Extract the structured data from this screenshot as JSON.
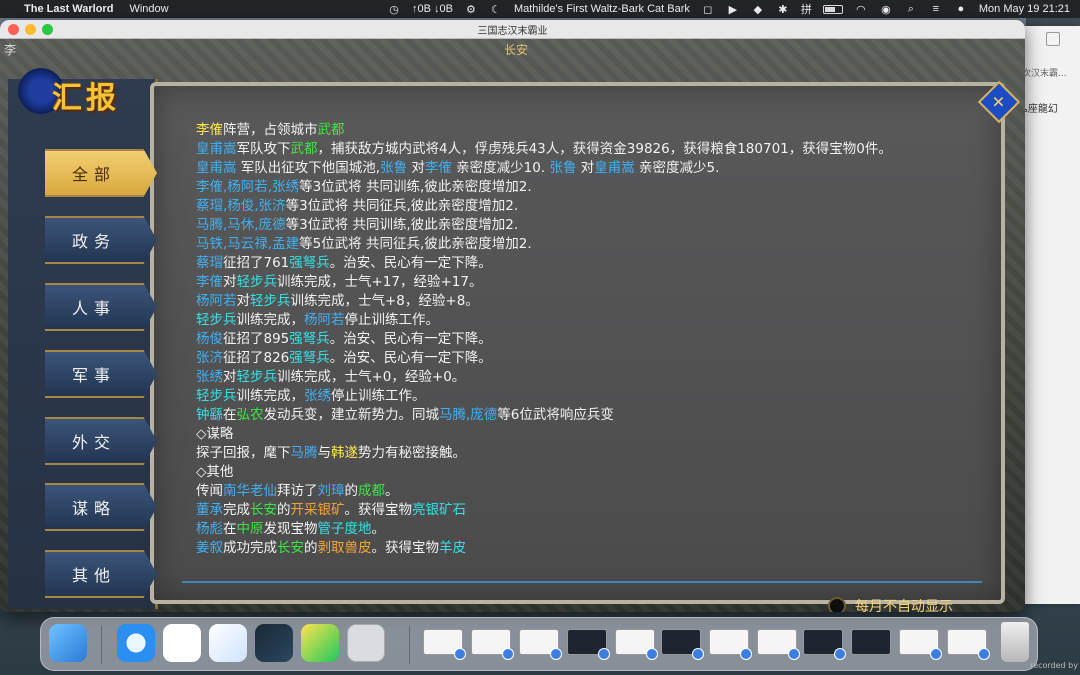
{
  "menubar": {
    "app_name": "The Last Warlord",
    "menu_window": "Window",
    "network": "↑0B ↓0B",
    "now_playing": "Mathilde's First Waltz-Bark Cat Bark",
    "input_method": "拼",
    "datetime": "Mon May 19  21:21"
  },
  "window": {
    "title": "三国志汉末霸业"
  },
  "game": {
    "hud_left": "李",
    "hud_city": "长安",
    "panel_title": "汇报",
    "categories": [
      "全部",
      "政务",
      "人事",
      "军事",
      "外交",
      "谋略",
      "其他"
    ],
    "report_lines": [
      [
        [
          "李傕",
          "y"
        ],
        [
          "阵营，占领城市",
          "w"
        ],
        [
          "武都",
          "g"
        ]
      ],
      [
        [
          "皇甫嵩",
          "b"
        ],
        [
          "军队攻下",
          "w"
        ],
        [
          "武都",
          "g"
        ],
        [
          "，捕获敌方城内武将4人，俘虏残兵43人，获得资金39826，获得粮食180701，获得宝物0件。",
          "w"
        ]
      ],
      [
        [
          "皇甫嵩",
          "b"
        ],
        [
          " 军队出征攻下他国城池,",
          "w"
        ],
        [
          "张鲁",
          "b"
        ],
        [
          " 对",
          "w"
        ],
        [
          "李傕",
          "b"
        ],
        [
          " 亲密度减少10. ",
          "w"
        ],
        [
          "张鲁",
          "b"
        ],
        [
          " 对",
          "w"
        ],
        [
          "皇甫嵩",
          "b"
        ],
        [
          " 亲密度减少5.",
          "w"
        ]
      ],
      [
        [
          "李傕,杨阿若,张绣",
          "b"
        ],
        [
          "等3位武将 共同训练,彼此亲密度增加2.",
          "w"
        ]
      ],
      [
        [
          "蔡瑁,杨俊,张济",
          "b"
        ],
        [
          "等3位武将 共同征兵,彼此亲密度增加2.",
          "w"
        ]
      ],
      [
        [
          "马腾,马休,庞德",
          "b"
        ],
        [
          "等3位武将 共同训练,彼此亲密度增加2.",
          "w"
        ]
      ],
      [
        [
          "马铁,马云禄,孟建",
          "b"
        ],
        [
          "等5位武将 共同征兵,彼此亲密度增加2.",
          "w"
        ]
      ],
      [
        [
          "蔡瑁",
          "b"
        ],
        [
          "征招了761",
          "w"
        ],
        [
          "强弩兵",
          "c"
        ],
        [
          "。治安、民心有一定下降。",
          "w"
        ]
      ],
      [
        [
          "李傕",
          "b"
        ],
        [
          "对",
          "w"
        ],
        [
          "轻步兵",
          "c"
        ],
        [
          "训练完成，士气+17，经验+17。",
          "w"
        ]
      ],
      [
        [
          "杨阿若",
          "b"
        ],
        [
          "对",
          "w"
        ],
        [
          "轻步兵",
          "c"
        ],
        [
          "训练完成，士气+8，经验+8。",
          "w"
        ]
      ],
      [
        [
          "轻步兵",
          "c"
        ],
        [
          "训练完成，",
          "w"
        ],
        [
          "杨阿若",
          "b"
        ],
        [
          "停止训练工作。",
          "w"
        ]
      ],
      [
        [
          "杨俊",
          "b"
        ],
        [
          "征招了895",
          "w"
        ],
        [
          "强弩兵",
          "c"
        ],
        [
          "。治安、民心有一定下降。",
          "w"
        ]
      ],
      [
        [
          "张济",
          "b"
        ],
        [
          "征招了826",
          "w"
        ],
        [
          "强弩兵",
          "c"
        ],
        [
          "。治安、民心有一定下降。",
          "w"
        ]
      ],
      [
        [
          "张绣",
          "b"
        ],
        [
          "对",
          "w"
        ],
        [
          "轻步兵",
          "c"
        ],
        [
          "训练完成，士气+0，经验+0。",
          "w"
        ]
      ],
      [
        [
          "轻步兵",
          "c"
        ],
        [
          "训练完成，",
          "w"
        ],
        [
          "张绣",
          "b"
        ],
        [
          "停止训练工作。",
          "w"
        ]
      ],
      [
        [
          " 钟繇",
          "c"
        ],
        [
          "在",
          "w"
        ],
        [
          "弘农",
          "g"
        ],
        [
          "发动兵变，建立新势力。同城",
          "w"
        ],
        [
          "马腾,庞德",
          "b"
        ],
        [
          "等6位武将响应兵变",
          "w"
        ]
      ],
      [
        [
          "◇谋略",
          "w"
        ]
      ],
      [
        [
          " 探子回报，麾下",
          "w"
        ],
        [
          "马腾",
          "b"
        ],
        [
          "与",
          "w"
        ],
        [
          "韩遂",
          "y"
        ],
        [
          "势力有秘密接触。",
          "w"
        ]
      ],
      [
        [
          "◇其他",
          "w"
        ]
      ],
      [
        [
          "传闻",
          "w"
        ],
        [
          "南华老仙",
          "b"
        ],
        [
          "拜访了",
          "w"
        ],
        [
          "刘璋",
          "b"
        ],
        [
          "的",
          "w"
        ],
        [
          "成都",
          "g"
        ],
        [
          "。",
          "w"
        ]
      ],
      [
        [
          "董承",
          "b"
        ],
        [
          "完成",
          "w"
        ],
        [
          "长安",
          "g"
        ],
        [
          "的",
          "w"
        ],
        [
          "开采银矿",
          "o"
        ],
        [
          "。获得宝物",
          "w"
        ],
        [
          "亮银矿石",
          "c"
        ]
      ],
      [
        [
          "杨彪",
          "b"
        ],
        [
          "在",
          "w"
        ],
        [
          "中原",
          "g"
        ],
        [
          "发现宝物",
          "w"
        ],
        [
          "管子度地",
          "c"
        ],
        [
          "。",
          "w"
        ]
      ],
      [
        [
          "姜叙",
          "b"
        ],
        [
          "成功完成",
          "w"
        ],
        [
          "长安",
          "g"
        ],
        [
          "的",
          "w"
        ],
        [
          "剥取兽皮",
          "o"
        ],
        [
          "。获得宝物",
          "w"
        ],
        [
          "羊皮",
          "c"
        ]
      ]
    ],
    "auto_toggle_label": "每月不自动显示"
  },
  "sidecard": {
    "line1": "次汉末霸...",
    "line2": "ь座龍幻"
  },
  "footer": {
    "recorded": "recorded by"
  },
  "colors": {
    "y": "#ffe94a",
    "b": "#3fb0f4",
    "c": "#35e0e6",
    "g": "#3de644",
    "w": "#f2f2f2",
    "o": "#f7a630"
  }
}
